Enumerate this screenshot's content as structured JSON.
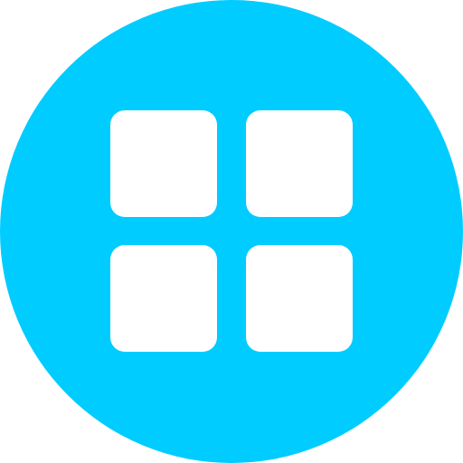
{
  "icon": {
    "name": "apps-grid-icon",
    "background_color": "#00CCFF",
    "tile_color": "#FFFFFF",
    "tiles": [
      {
        "name": "grid-tile-top-left"
      },
      {
        "name": "grid-tile-top-right"
      },
      {
        "name": "grid-tile-bottom-left"
      },
      {
        "name": "grid-tile-bottom-right"
      }
    ]
  }
}
